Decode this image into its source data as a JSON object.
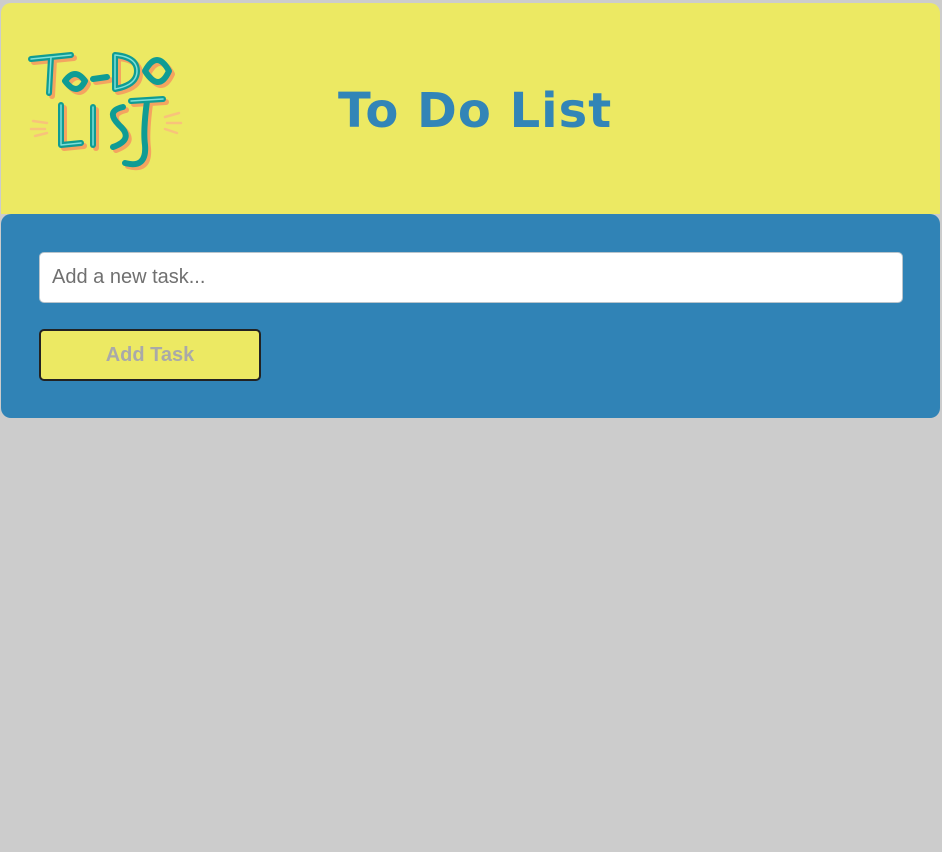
{
  "header": {
    "logo_text": "To-Do List",
    "title": "To Do List"
  },
  "form": {
    "placeholder": "Add a new task...",
    "value": "",
    "add_button_label": "Add Task"
  },
  "tasks": [],
  "colors": {
    "page_background": "#cccccc",
    "header_background": "#ece963",
    "panel_background": "#3083b6",
    "title_color": "#3285b7",
    "logo_teal": "#0f9c94",
    "logo_shadow": "#f4a460"
  }
}
